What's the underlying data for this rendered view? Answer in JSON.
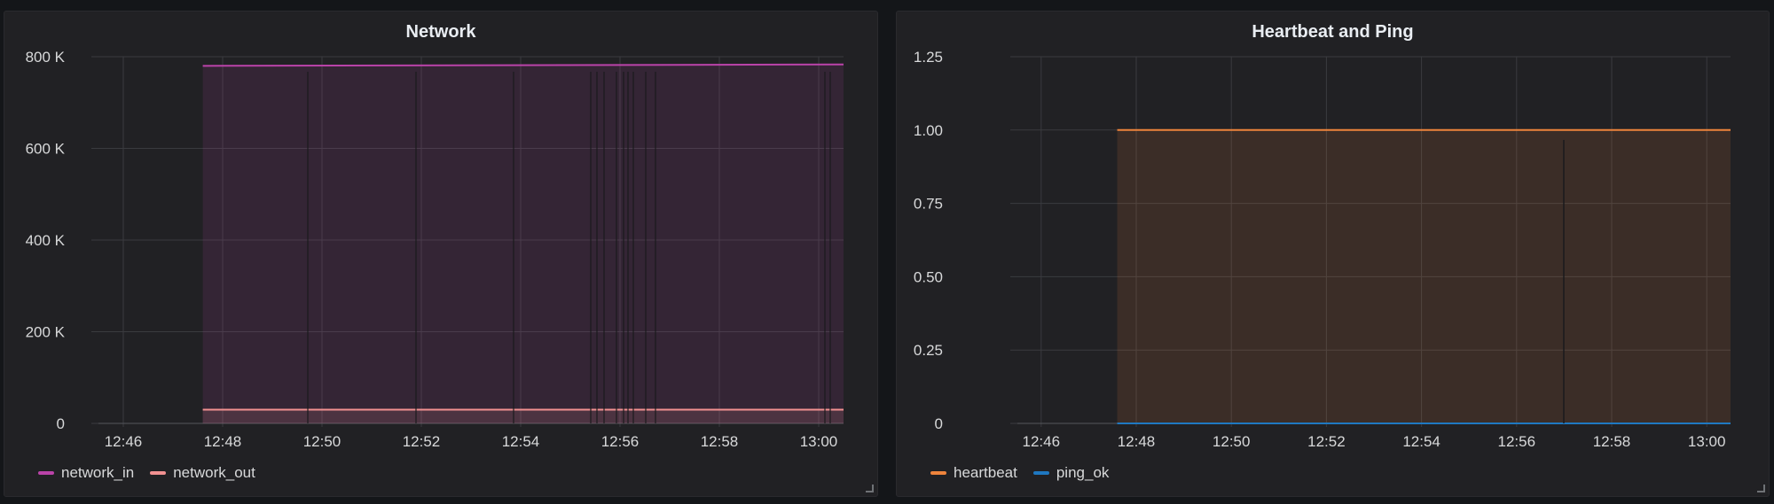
{
  "panels": [
    {
      "title": "Network",
      "legend": [
        {
          "name": "network_in",
          "color": "#ba43a9"
        },
        {
          "name": "network_out",
          "color": "#f29191"
        }
      ]
    },
    {
      "title": "Heartbeat and Ping",
      "legend": [
        {
          "name": "heartbeat",
          "color": "#ef843c"
        },
        {
          "name": "ping_ok",
          "color": "#1f78c1"
        }
      ]
    }
  ],
  "chart_data": [
    {
      "type": "area",
      "title": "Network",
      "x_ticks": [
        "12:46",
        "12:48",
        "12:50",
        "12:52",
        "12:54",
        "12:56",
        "12:58",
        "13:00"
      ],
      "y_ticks": [
        "0",
        "200 K",
        "400 K",
        "600 K",
        "800 K"
      ],
      "ylim": [
        0,
        800000
      ],
      "x_range": [
        "12:45:30",
        "13:00:30"
      ],
      "grid": true,
      "legend_position": "bottom-left",
      "x": [
        "12:47:36",
        "13:00:30"
      ],
      "series": [
        {
          "name": "network_in",
          "color": "#ba43a9",
          "values": [
            780000,
            783000
          ]
        },
        {
          "name": "network_out",
          "color": "#f29191",
          "values": [
            30000,
            30000
          ]
        }
      ]
    },
    {
      "type": "area",
      "title": "Heartbeat and Ping",
      "x_ticks": [
        "12:46",
        "12:48",
        "12:50",
        "12:52",
        "12:54",
        "12:56",
        "12:58",
        "13:00"
      ],
      "y_ticks": [
        "0",
        "0.25",
        "0.50",
        "0.75",
        "1.00",
        "1.25"
      ],
      "ylim": [
        0,
        1.25
      ],
      "x_range": [
        "12:45:30",
        "13:00:30"
      ],
      "grid": true,
      "legend_position": "bottom-left",
      "x": [
        "12:47:36",
        "13:00:30"
      ],
      "series": [
        {
          "name": "heartbeat",
          "color": "#ef843c",
          "values": [
            1,
            1
          ]
        },
        {
          "name": "ping_ok",
          "color": "#1f78c1",
          "values": [
            0,
            0
          ]
        }
      ]
    }
  ]
}
